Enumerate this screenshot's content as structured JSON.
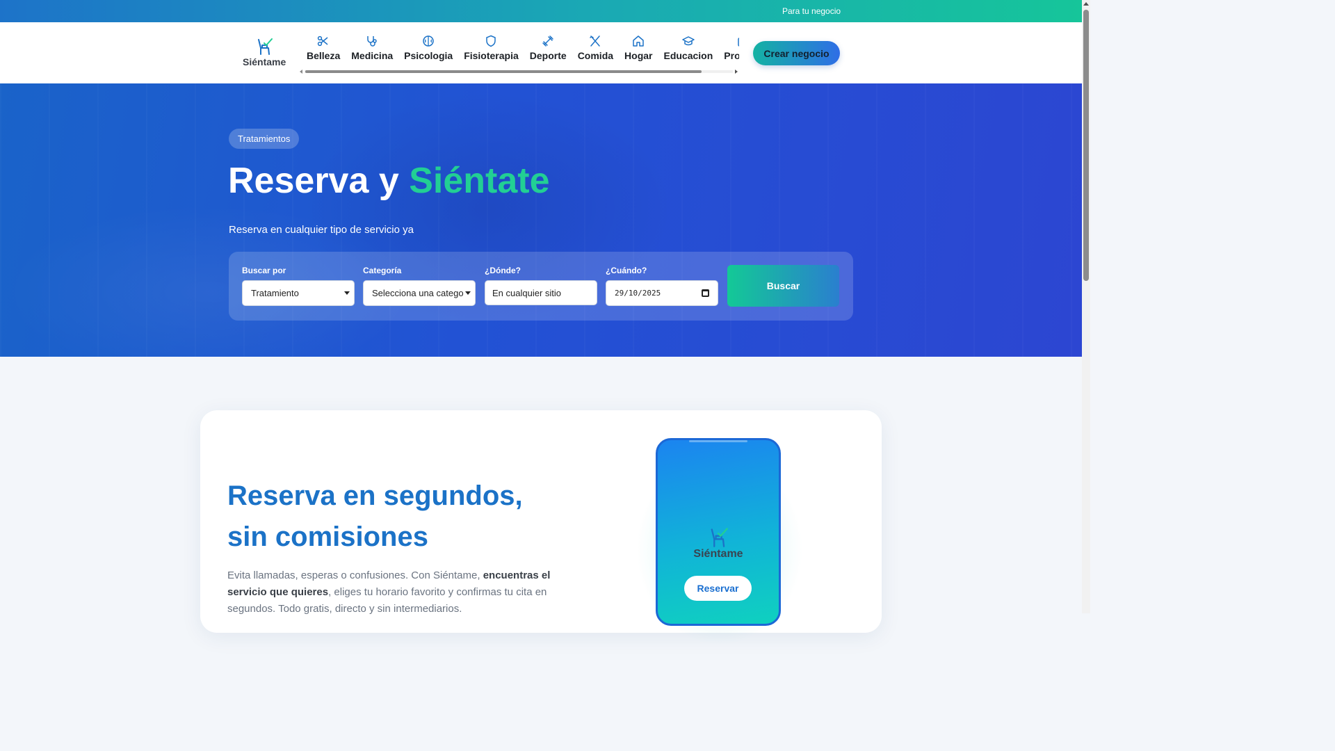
{
  "topbar": {
    "link": "Para tu negocio"
  },
  "header": {
    "brand": "Siéntame",
    "nav": [
      {
        "label": "Belleza",
        "icon": "scissors-icon"
      },
      {
        "label": "Medicina",
        "icon": "stethoscope-icon"
      },
      {
        "label": "Psicologia",
        "icon": "brain-icon"
      },
      {
        "label": "Fisioterapia",
        "icon": "shield-icon"
      },
      {
        "label": "Deporte",
        "icon": "dumbbell-icon"
      },
      {
        "label": "Comida",
        "icon": "utensils-icon"
      },
      {
        "label": "Hogar",
        "icon": "home-icon"
      },
      {
        "label": "Educacion",
        "icon": "graduation-cap-icon"
      },
      {
        "label": "Profesio",
        "icon": "briefcase-icon"
      }
    ],
    "cta": "Crear negocio"
  },
  "hero": {
    "badge": "Tratamientos",
    "title_main": "Reserva y ",
    "title_accent": "Siéntate",
    "subtitle": "Reserva en cualquier tipo de servicio ya",
    "search": {
      "buscar_por": {
        "label": "Buscar por",
        "value": "Tratamiento"
      },
      "categoria": {
        "label": "Categoría",
        "value": "Selecciona una catego"
      },
      "donde": {
        "label": "¿Dónde?",
        "value": "En cualquier sitio"
      },
      "cuando": {
        "label": "¿Cuándo?",
        "value": "29/10/2025"
      },
      "button": "Buscar"
    }
  },
  "feature": {
    "title": "Reserva en segundos, sin comisiones",
    "text_1": "Evita llamadas, esperas o confusiones. Con Siéntame, ",
    "text_bold": "encuentras el servicio que quieres",
    "text_2": ", eliges tu horario favorito y confirmas tu cita en segundos. Todo gratis, directo y sin intermediarios.",
    "phone": {
      "brand": "Siéntame",
      "button": "Reservar"
    }
  },
  "colors": {
    "brand_blue": "#1b72c7",
    "accent_green": "#22cf94",
    "hero_bg": "#2252d4"
  }
}
